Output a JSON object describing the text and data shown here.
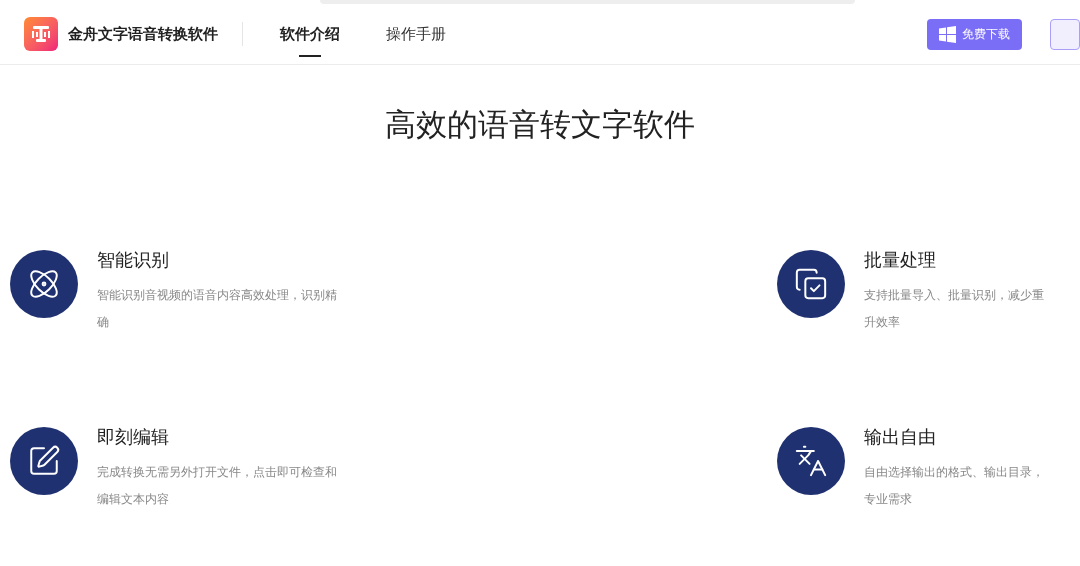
{
  "header": {
    "app_name": "金舟文字语音转换软件",
    "nav": [
      {
        "label": "软件介绍",
        "selected": true
      },
      {
        "label": "操作手册",
        "selected": false
      }
    ],
    "download_button": "免费下载"
  },
  "heading": "高效的语音转文字软件",
  "features": [
    {
      "title": "智能识别",
      "lines": [
        "智能识别音视频的语音内容高效处理，识别精",
        "确"
      ]
    },
    {
      "title": "批量处理",
      "lines": [
        "支持批量导入、批量识别，减少重",
        "升效率"
      ]
    },
    {
      "title": "即刻编辑",
      "lines": [
        "完成转换无需另外打开文件，点击即可检查和",
        "编辑文本内容"
      ]
    },
    {
      "title": "输出自由",
      "lines": [
        "自由选择输出的格式、输出目录，",
        "专业需求"
      ]
    }
  ]
}
